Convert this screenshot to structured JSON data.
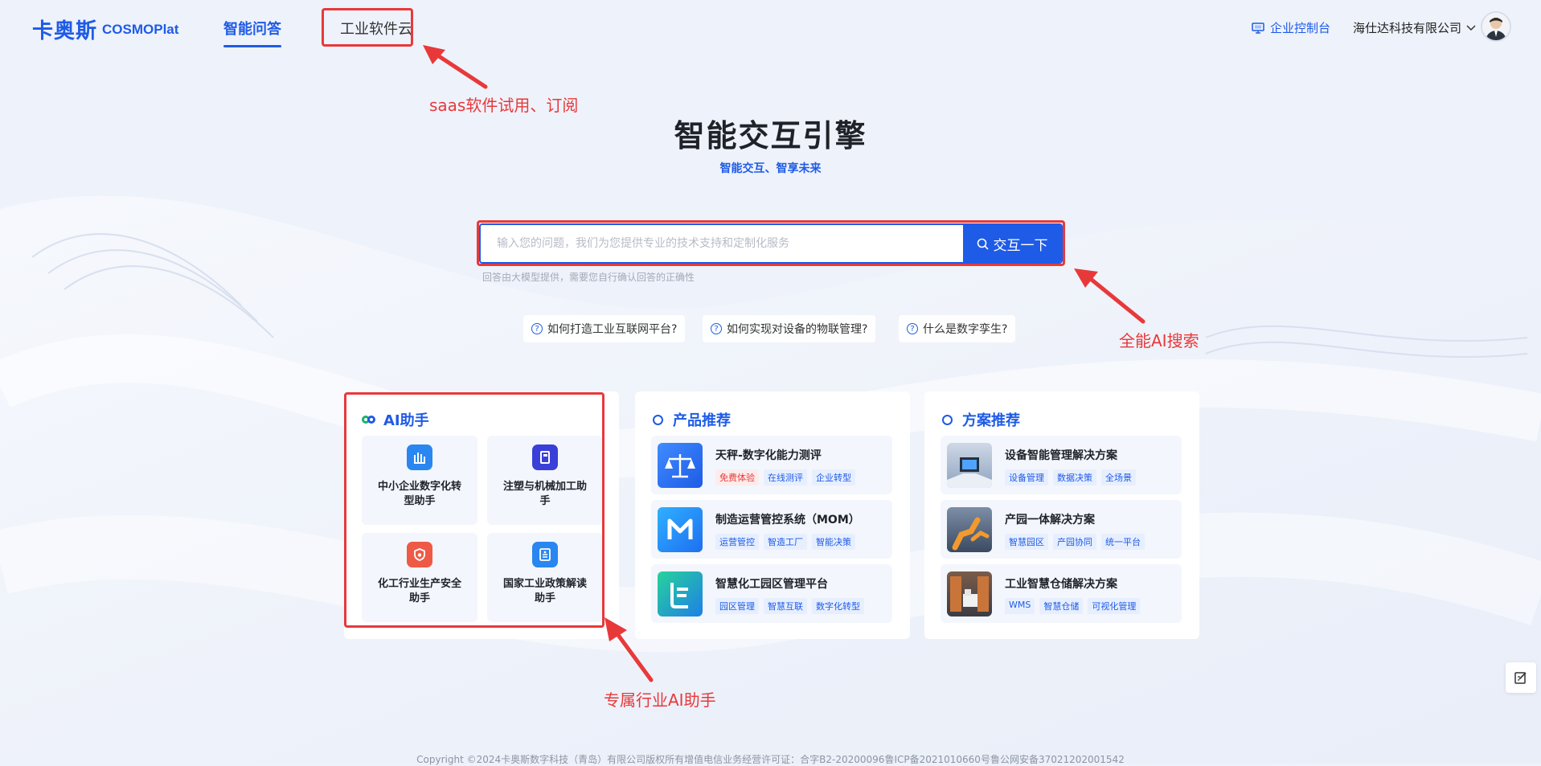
{
  "header": {
    "logo_cn": "卡奥斯",
    "logo_en": "COSMOPlat",
    "nav": [
      "智能问答",
      "工业软件云"
    ],
    "console_link": "企业控制台",
    "company": "海仕达科技有限公司"
  },
  "hero": {
    "title": "智能交互引擎",
    "subtitle": "智能交互、智享未来"
  },
  "search": {
    "placeholder": "输入您的问题，我们为您提供专业的技术支持和定制化服务",
    "button": "交互一下",
    "note": "回答由大模型提供，需要您自行确认回答的正确性"
  },
  "suggestions": [
    "如何打造工业互联网平台?",
    "如何实现对设备的物联管理?",
    "什么是数字孪生?"
  ],
  "ai_card": {
    "title": "AI助手",
    "tiles": [
      {
        "label": "中小企业数字化转型助手",
        "icon": "building-icon",
        "color": "#2a86f0"
      },
      {
        "label": "注塑与机械加工助手",
        "icon": "machine-icon",
        "color": "#3a3fd8"
      },
      {
        "label": "化工行业生产安全助手",
        "icon": "shield-icon",
        "color": "#ee5a45"
      },
      {
        "label": "国家工业政策解读助手",
        "icon": "document-icon",
        "color": "#2a86f0"
      }
    ]
  },
  "product_card": {
    "title": "产品推荐",
    "items": [
      {
        "title": "天秤-数字化能力测评",
        "tags": [
          "免费体验",
          "在线测评",
          "企业转型"
        ],
        "icon": "scale-icon"
      },
      {
        "title": "制造运营管控系统（MOM）",
        "tags": [
          "运营管控",
          "智造工厂",
          "智能决策"
        ],
        "icon": "m-logo-icon"
      },
      {
        "title": "智慧化工园区管理平台",
        "tags": [
          "园区管理",
          "智慧互联",
          "数字化转型"
        ],
        "icon": "park-logo-icon"
      }
    ]
  },
  "solution_card": {
    "title": "方案推荐",
    "items": [
      {
        "title": "设备智能管理解决方案",
        "tags": [
          "设备管理",
          "数据决策",
          "全场景"
        ],
        "icon": "device-photo"
      },
      {
        "title": "产园一体解决方案",
        "tags": [
          "智慧园区",
          "产园协同",
          "统一平台"
        ],
        "icon": "robot-arm-photo"
      },
      {
        "title": "工业智慧仓储解决方案",
        "tags": [
          "WMS",
          "智慧仓储",
          "可视化管理"
        ],
        "icon": "warehouse-photo"
      }
    ]
  },
  "annotations": {
    "software_cloud": "saas软件试用、订阅",
    "search": "全能AI搜索",
    "assistant": "专属行业AI助手"
  },
  "footer": "Copyright ©2024卡奥斯数字科技（青岛）有限公司版权所有增值电信业务经营许可证：合字B2-20200096鲁ICP备2021010660号鲁公网安备37021202001542",
  "colors": {
    "brand": "#1e5be6",
    "annotation": "#e8393a",
    "background": "#eef2fb"
  }
}
